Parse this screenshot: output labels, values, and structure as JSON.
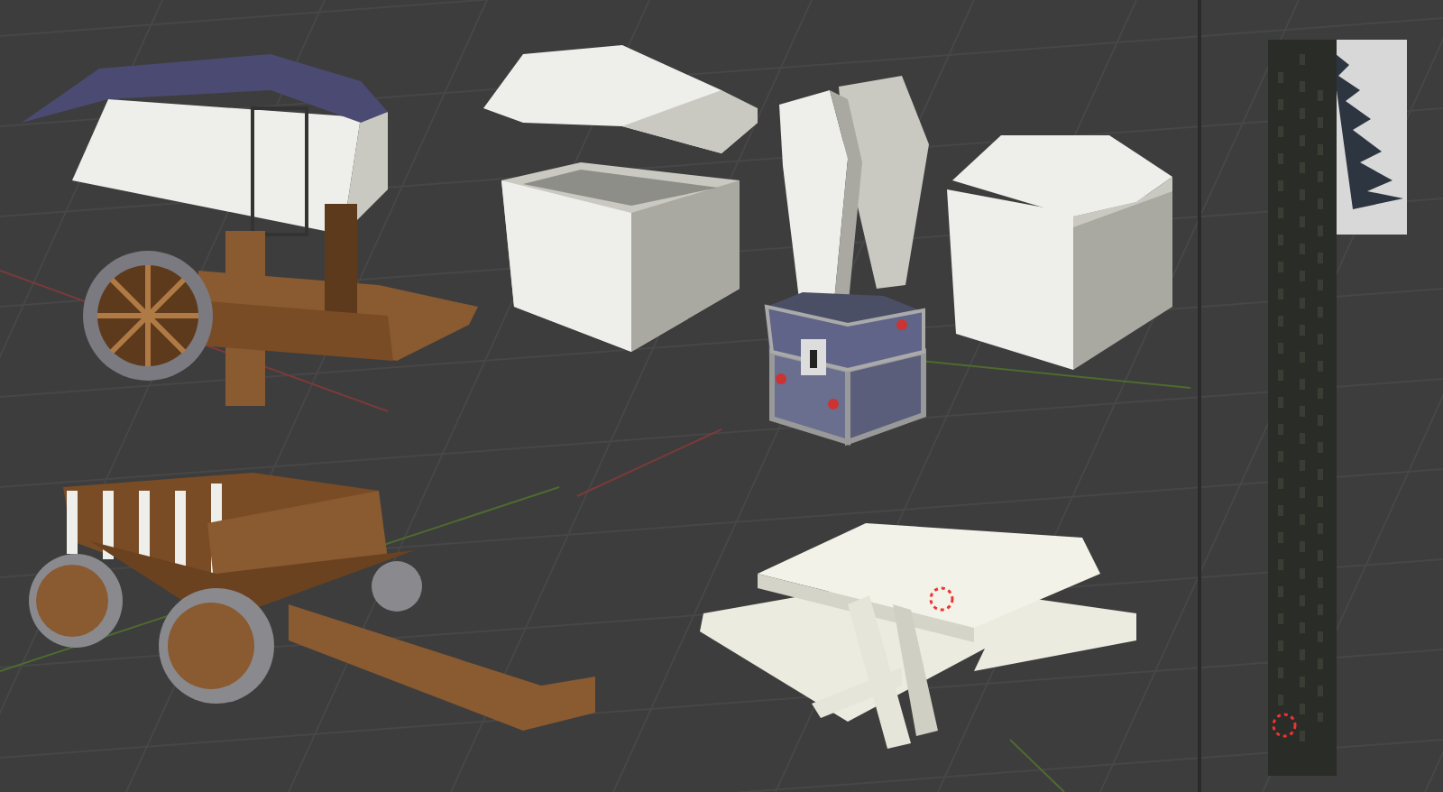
{
  "viewport": {
    "models": [
      {
        "kind": "covered-wagon"
      },
      {
        "kind": "open-chest"
      },
      {
        "kind": "coffin"
      },
      {
        "kind": "treasure-chest"
      },
      {
        "kind": "lidded-box"
      },
      {
        "kind": "tree-trunk"
      },
      {
        "kind": "cart"
      },
      {
        "kind": "picnic-table"
      }
    ]
  }
}
